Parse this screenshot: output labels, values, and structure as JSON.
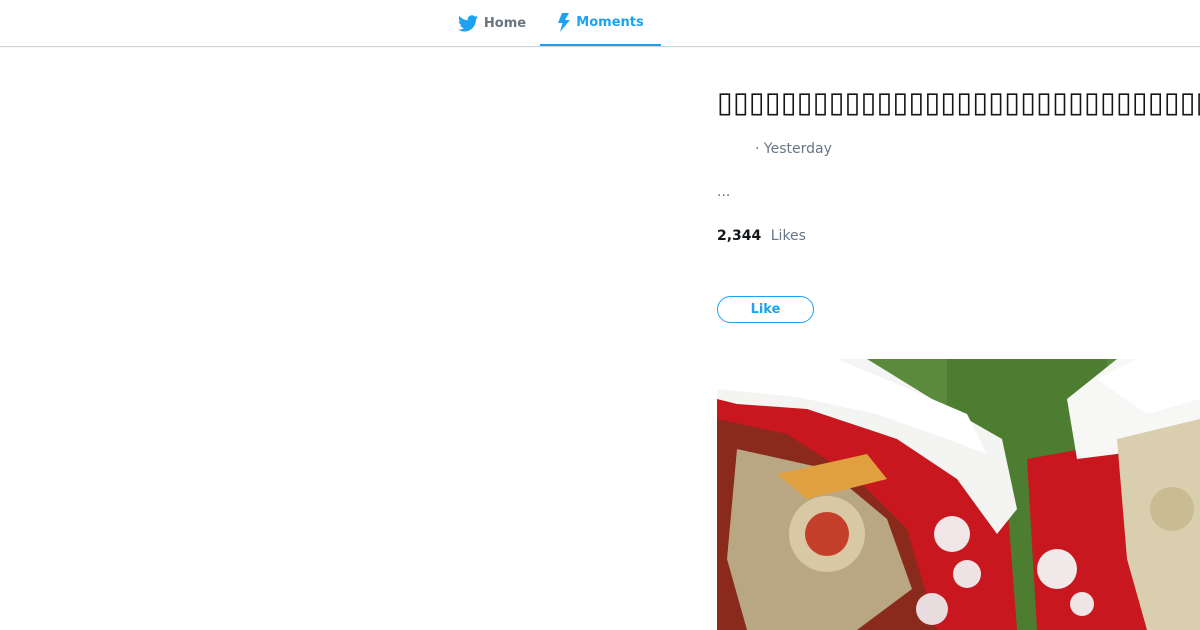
{
  "nav": {
    "home_label": "Home",
    "moments_label": "Moments",
    "home_icon": "twitter-bird-icon",
    "moments_icon": "lightning-bolt-icon",
    "accent_color": "#1da1f2"
  },
  "moment": {
    "title": "▯▯▯▯▯▯▯▯▯▯▯▯▯▯▯▯▯▯▯▯▯▯▯▯▯▯▯▯▯▯▯▯▯",
    "timestamp": "· Yesterday",
    "description": "...",
    "likes_count": "2,344",
    "likes_label": "Likes",
    "like_button_label": "Like"
  }
}
